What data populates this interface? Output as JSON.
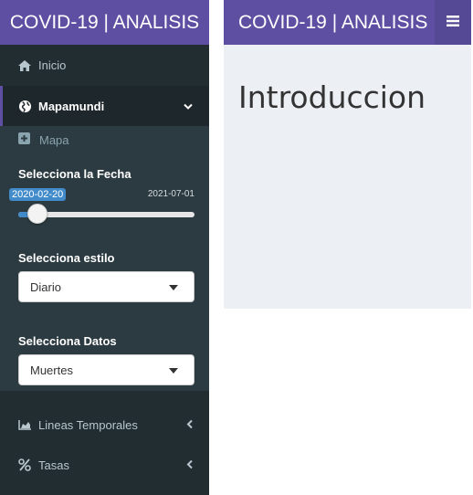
{
  "brand_left": "COVID-19 | ANALISIS",
  "brand_right": "COVID-19 | ANALISIS",
  "menu": {
    "inicio": {
      "label": "Inicio",
      "icon": "home-icon"
    },
    "mapamundi": {
      "label": "Mapamundi",
      "icon": "globe-icon",
      "expanded": true
    },
    "mapa": {
      "label": "Mapa",
      "icon": "plus-square-icon"
    },
    "lineas": {
      "label": "Lineas Temporales",
      "icon": "area-chart-icon"
    },
    "tasas": {
      "label": "Tasas",
      "icon": "percent-icon"
    }
  },
  "date_slider": {
    "label": "Selecciona la Fecha",
    "selected": "2020-02-20",
    "max_label": "2021-07-01",
    "position_fraction": 0.0
  },
  "style_select": {
    "label": "Selecciona estilo",
    "value": "Diario"
  },
  "data_select": {
    "label": "Selecciona Datos",
    "value": "Muertes"
  },
  "main": {
    "heading": "Introduccion"
  },
  "colors": {
    "brand": "#5f4fa2",
    "sidebar": "#222d32",
    "accent": "#428bca",
    "content_bg": "#ecf0f5"
  }
}
